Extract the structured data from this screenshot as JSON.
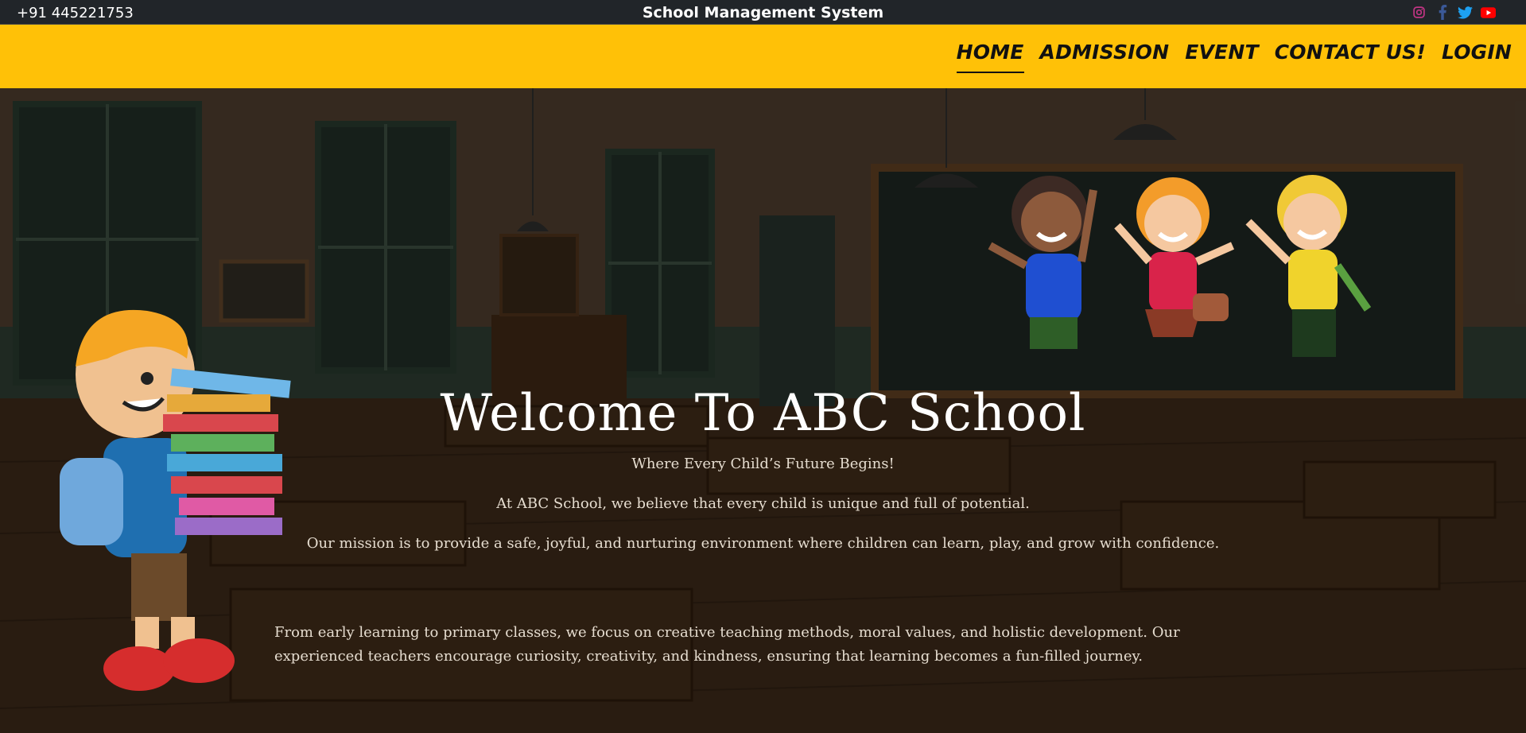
{
  "topbar": {
    "phone": "+91 445221753",
    "brand": "School Management System",
    "socials": [
      {
        "icon": "instagram-icon",
        "color": "#c13584"
      },
      {
        "icon": "facebook-icon",
        "color": "#3b5998"
      },
      {
        "icon": "twitter-icon",
        "color": "#1da1f2"
      },
      {
        "icon": "youtube-icon",
        "color": "#ff0000"
      }
    ]
  },
  "nav": {
    "items": [
      {
        "label": "HOME",
        "active": true
      },
      {
        "label": "ADMISSION"
      },
      {
        "label": "EVENT"
      },
      {
        "label": "CONTACT US!"
      },
      {
        "label": "LOGIN"
      }
    ]
  },
  "hero": {
    "title": "Welcome To ABC School",
    "tagline": "Where Every Child’s Future Begins!",
    "paragraph1": "At ABC School, we believe that every child is unique and full of potential.",
    "paragraph2": "Our mission is to provide a safe, joyful, and nurturing environment where children can learn, play, and grow with confidence.",
    "paragraph3": "From early learning to primary classes, we focus on creative teaching methods, moral values, and holistic development. Our experienced teachers encourage curiosity, creativity, and kindness, ensuring that learning becomes a fun-filled journey."
  },
  "colors": {
    "topbar_bg": "#212529",
    "navbar_bg": "#ffc107"
  }
}
